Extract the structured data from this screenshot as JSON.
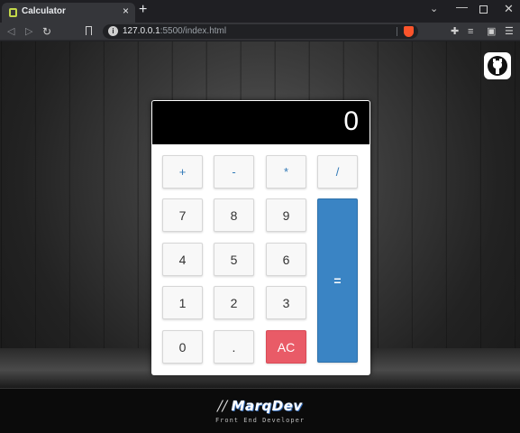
{
  "browser": {
    "tab_title": "Calculator",
    "tab_close": "×",
    "new_tab": "+",
    "url_host": "127.0.0.1",
    "url_path": ":5500/index.html",
    "nav_back": "◁",
    "nav_forward": "▷",
    "nav_reload": "↻",
    "window_search": "⌄",
    "window_minimize": "—",
    "window_close": "✕",
    "menu": "☰",
    "extensions": "✚",
    "playlist": "≡",
    "wallet": "▣"
  },
  "calculator": {
    "display": "0",
    "keys": {
      "plus": "+",
      "minus": "-",
      "multiply": "*",
      "divide": "/",
      "seven": "7",
      "eight": "8",
      "nine": "9",
      "four": "4",
      "five": "5",
      "six": "6",
      "one": "1",
      "two": "2",
      "three": "3",
      "zero": "0",
      "dot": ".",
      "clear": "AC",
      "equals": "="
    }
  },
  "footer": {
    "brand_prefix": "//",
    "brand_name": "MarqDev",
    "subtitle": "Front End Developer"
  },
  "colors": {
    "accent_blue": "#3a84c4",
    "clear_red": "#e95b67",
    "display_bg": "#000000"
  },
  "icons": {
    "github": "github-icon"
  }
}
